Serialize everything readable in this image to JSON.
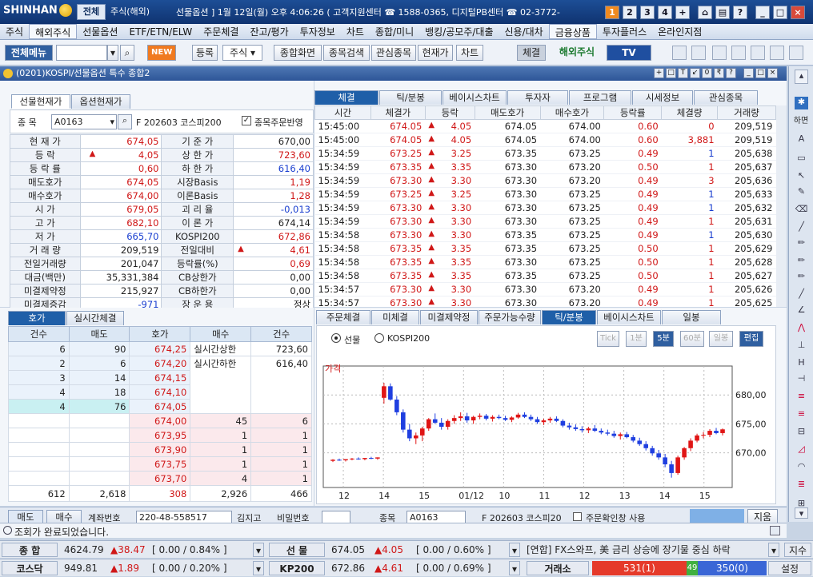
{
  "titlebar": {
    "logo": "SHINHAN",
    "tab_all": "전체",
    "tab_overseas": "주식(해외)",
    "status": "선물옵션 ] 1월 12일(월) 오후 4:06:26 ( 고객지원센터 ☎ 1588-0365, 디지털PB센터 ☎ 02-3772-",
    "page_buttons": [
      "1",
      "2",
      "3",
      "4",
      "+"
    ]
  },
  "menu": [
    "주식",
    "해외주식",
    "선물옵션",
    "ETF/ETN/ELW",
    "주문체결",
    "잔고/평가",
    "투자정보",
    "차트",
    "종합/미니",
    "뱅킹/공모주/대출",
    "신용/대차",
    "금융상품",
    "투자플러스",
    "온라인지점"
  ],
  "menu_selected": "해외주식",
  "toolbar": {
    "all_menu": "전체메뉴",
    "new_badge": "NEW",
    "register": "등록",
    "stock_select": "주식",
    "combined_screen": "종합화면",
    "search_stock": "종목검색",
    "interest": "관심종목",
    "current_price": "현재가",
    "chart": "차트",
    "trade": "체결",
    "overseas_stock": "해외주식",
    "tv": "TV"
  },
  "window": {
    "title": "(0201)KOSPI/선물옵션 특수 종합2",
    "ctrl_buttons": [
      "+",
      "□",
      "T",
      "↙",
      "0",
      "₹",
      "?",
      "_",
      "□",
      "×"
    ]
  },
  "quote_panel": {
    "tabs": [
      "선물현재가",
      "옵션현재가"
    ],
    "code_label": "종  목",
    "code": "A0163",
    "product": "F 202603 코스피200",
    "order_checkbox": "종목주문반영",
    "rows": [
      {
        "l1": "현 재 가",
        "v1": "674,05",
        "c1": "red",
        "l2": "기 준 가",
        "v2": "670,00",
        "c2": ""
      },
      {
        "l1": "등    락",
        "v1": "4,05",
        "c1": "red",
        "arrow": "▲",
        "l2": "상 한 가",
        "v2": "723,60",
        "c2": "red"
      },
      {
        "l1": "등 락 률",
        "v1": "0,60",
        "c1": "red",
        "l2": "하 한 가",
        "v2": "616,40",
        "c2": "blue"
      },
      {
        "l1": "매도호가",
        "v1": "674,05",
        "c1": "red",
        "l2": "시장Basis",
        "v2": "1,19",
        "c2": "red"
      },
      {
        "l1": "매수호가",
        "v1": "674,00",
        "c1": "red",
        "l2": "이론Basis",
        "v2": "1,28",
        "c2": "red"
      },
      {
        "l1": "시    가",
        "v1": "679,05",
        "c1": "red",
        "l2": "괴 리 율",
        "v2": "-0,013",
        "c2": "blue"
      },
      {
        "l1": "고    가",
        "v1": "682,10",
        "c1": "red",
        "l2": "이 론 가",
        "v2": "674,14",
        "c2": ""
      },
      {
        "l1": "저    가",
        "v1": "665,70",
        "c1": "blue",
        "l2": "KOSPI200",
        "v2": "672,86",
        "c2": "red"
      },
      {
        "l1": "거 래 량",
        "v1": "209,519",
        "c1": "",
        "l2": "전일대비",
        "v2": "4,61",
        "c2": "red",
        "arrow2": "▲"
      },
      {
        "l1": "전일거래량",
        "v1": "201,047",
        "c1": "",
        "l2": "등락률(%)",
        "v2": "0,69",
        "c2": "red"
      },
      {
        "l1": "대금(백만)",
        "v1": "35,331,384",
        "c1": "",
        "l2": "CB상한가",
        "v2": "0,00",
        "c2": ""
      },
      {
        "l1": "미결제약정",
        "v1": "215,927",
        "c1": "",
        "l2": "CB하한가",
        "v2": "0,00",
        "c2": ""
      },
      {
        "l1": "미결제증감",
        "v1": "-971",
        "c1": "blue",
        "l2": "장 운 용",
        "v2": "정상",
        "c2": ""
      }
    ]
  },
  "trade_panel": {
    "tabs": [
      "체결",
      "틱/분봉",
      "베이시스차트",
      "투자자",
      "프로그램",
      "시세정보",
      "관심종목"
    ],
    "headers": [
      "시간",
      "체결가",
      "등락",
      "매도호가",
      "매수호가",
      "등락률",
      "체결량",
      "거래량"
    ],
    "rows": [
      [
        "15:45:00",
        "674.05",
        "4.05",
        "674.05",
        "674.00",
        "0.60",
        "0",
        "209,519",
        "red"
      ],
      [
        "15:45:00",
        "674.05",
        "4.05",
        "674.05",
        "674.00",
        "0.60",
        "3,881",
        "209,519",
        "red"
      ],
      [
        "15:34:59",
        "673.25",
        "3.25",
        "673.35",
        "673.25",
        "0.49",
        "1",
        "205,638",
        "blue"
      ],
      [
        "15:34:59",
        "673.35",
        "3.35",
        "673.30",
        "673.20",
        "0.50",
        "1",
        "205,637",
        "red"
      ],
      [
        "15:34:59",
        "673.30",
        "3.30",
        "673.30",
        "673.20",
        "0.49",
        "3",
        "205,636",
        "red"
      ],
      [
        "15:34:59",
        "673.25",
        "3.25",
        "673.30",
        "673.25",
        "0.49",
        "1",
        "205,633",
        "blue"
      ],
      [
        "15:34:59",
        "673.30",
        "3.30",
        "673.30",
        "673.25",
        "0.49",
        "1",
        "205,632",
        "blue"
      ],
      [
        "15:34:59",
        "673.30",
        "3.30",
        "673.30",
        "673.25",
        "0.49",
        "1",
        "205,631",
        "red"
      ],
      [
        "15:34:58",
        "673.30",
        "3.30",
        "673.35",
        "673.25",
        "0.49",
        "1",
        "205,630",
        "blue"
      ],
      [
        "15:34:58",
        "673.35",
        "3.35",
        "673.35",
        "673.25",
        "0.50",
        "1",
        "205,629",
        "red"
      ],
      [
        "15:34:58",
        "673.35",
        "3.35",
        "673.30",
        "673.25",
        "0.50",
        "1",
        "205,628",
        "red"
      ],
      [
        "15:34:58",
        "673.35",
        "3.35",
        "673.35",
        "673.25",
        "0.50",
        "1",
        "205,627",
        "red"
      ],
      [
        "15:34:57",
        "673.30",
        "3.30",
        "673.30",
        "673.20",
        "0.49",
        "1",
        "205,626",
        "red"
      ],
      [
        "15:34:57",
        "673.30",
        "3.30",
        "673.30",
        "673.20",
        "0.49",
        "1",
        "205,625",
        "red"
      ]
    ]
  },
  "orderbook": {
    "tabs": [
      "호가",
      "실시간체결"
    ],
    "headers": [
      "건수",
      "매도",
      "호가",
      "매수",
      "건수"
    ],
    "asks": [
      {
        "cnt": "6",
        "qty": "90",
        "price": "674,25"
      },
      {
        "cnt": "2",
        "qty": "6",
        "price": "674,20"
      },
      {
        "cnt": "3",
        "qty": "14",
        "price": "674,15"
      },
      {
        "cnt": "4",
        "qty": "18",
        "price": "674,10"
      },
      {
        "cnt": "4",
        "qty": "76",
        "price": "674,05"
      }
    ],
    "bids": [
      {
        "price": "674,00",
        "qty": "45",
        "cnt": "6"
      },
      {
        "price": "673,95",
        "qty": "1",
        "cnt": "1"
      },
      {
        "price": "673,90",
        "qty": "1",
        "cnt": "1"
      },
      {
        "price": "673,75",
        "qty": "1",
        "cnt": "1"
      },
      {
        "price": "673,70",
        "qty": "4",
        "cnt": "1"
      }
    ],
    "upper_label": "실시간상한",
    "upper_value": "723,60",
    "lower_label": "실시간하한",
    "lower_value": "616,40",
    "totals": [
      "612",
      "2,618",
      "308",
      "2,926",
      "466"
    ]
  },
  "chart_panel": {
    "tabs": [
      "주문체결",
      "미체결",
      "미결제약정",
      "주문가능수량",
      "틱/분봉",
      "베이시스차트",
      "일봉"
    ],
    "radio_futures": "선물",
    "radio_kospi": "KOSPI200",
    "interval_buttons": [
      "Tick",
      "1분",
      "5분",
      "60분",
      "일봉"
    ],
    "edit_button": "편집",
    "price_label": "가격"
  },
  "chart_data": {
    "type": "candlestick",
    "y_ticks": [
      "680,00",
      "675,00",
      "670,00"
    ],
    "y_tick_values": [
      680,
      675,
      670
    ],
    "ylim": [
      664,
      685
    ],
    "x_ticks": [
      "12",
      "14",
      "15",
      "01/12",
      "10",
      "11",
      "12",
      "13",
      "14",
      "15"
    ],
    "colors": {
      "up": "#e01515",
      "down": "#1f3fe0"
    },
    "candles": [
      [
        668.6,
        668.9,
        668.4,
        668.8
      ],
      [
        668.8,
        669.0,
        668.6,
        668.7
      ],
      [
        668.7,
        668.9,
        668.5,
        668.9
      ],
      [
        668.9,
        669.1,
        668.7,
        669.0
      ],
      [
        669.0,
        669.2,
        668.8,
        668.9
      ],
      [
        668.9,
        669.1,
        668.7,
        669.1
      ],
      [
        669.1,
        669.3,
        668.9,
        669.0
      ],
      [
        669.0,
        669.2,
        668.8,
        669.2
      ],
      [
        679.5,
        682.1,
        678.5,
        681.5
      ],
      [
        681.5,
        682.0,
        679.0,
        679.2
      ],
      [
        679.2,
        679.8,
        676.5,
        677.0
      ],
      [
        677.0,
        677.5,
        673.5,
        674.0
      ],
      [
        674.0,
        675.0,
        672.0,
        672.5
      ],
      [
        672.5,
        673.5,
        671.5,
        673.0
      ],
      [
        673.0,
        674.5,
        672.0,
        674.2
      ],
      [
        674.2,
        676.0,
        673.8,
        675.8
      ],
      [
        675.8,
        676.8,
        675.0,
        675.2
      ],
      [
        675.2,
        676.0,
        674.0,
        674.5
      ],
      [
        674.5,
        675.8,
        674.0,
        675.5
      ],
      [
        675.5,
        676.5,
        675.0,
        676.0
      ],
      [
        676.0,
        677.0,
        675.5,
        676.3
      ],
      [
        676.3,
        676.9,
        675.2,
        675.6
      ],
      [
        675.6,
        676.4,
        675.0,
        676.2
      ],
      [
        676.2,
        676.8,
        675.8,
        676.4
      ],
      [
        676.4,
        676.7,
        675.6,
        675.9
      ],
      [
        675.9,
        676.5,
        675.4,
        676.2
      ],
      [
        676.2,
        676.6,
        675.8,
        676.0
      ],
      [
        676.0,
        676.4,
        675.5,
        675.7
      ],
      [
        675.7,
        676.3,
        675.3,
        676.1
      ],
      [
        676.1,
        676.9,
        675.9,
        676.6
      ],
      [
        676.6,
        677.0,
        676.0,
        676.2
      ],
      [
        676.2,
        676.6,
        675.5,
        675.8
      ],
      [
        675.8,
        676.2,
        675.0,
        675.3
      ],
      [
        675.3,
        675.9,
        674.8,
        675.6
      ],
      [
        675.6,
        676.2,
        675.2,
        675.9
      ],
      [
        675.9,
        676.3,
        675.3,
        675.5
      ],
      [
        675.5,
        675.8,
        674.4,
        674.7
      ],
      [
        674.7,
        675.2,
        674.0,
        674.4
      ],
      [
        674.4,
        674.9,
        673.8,
        674.1
      ],
      [
        674.1,
        674.6,
        673.5,
        673.9
      ],
      [
        673.9,
        674.5,
        673.4,
        674.2
      ],
      [
        674.2,
        674.8,
        673.6,
        673.8
      ],
      [
        673.8,
        674.2,
        673.2,
        673.5
      ],
      [
        673.5,
        674.0,
        673.0,
        673.3
      ],
      [
        673.3,
        673.8,
        672.6,
        672.9
      ],
      [
        672.9,
        673.5,
        672.3,
        673.2
      ],
      [
        673.2,
        673.6,
        672.5,
        672.7
      ],
      [
        672.7,
        673.1,
        671.8,
        672.1
      ],
      [
        672.1,
        672.6,
        671.2,
        671.5
      ],
      [
        671.5,
        672.0,
        670.4,
        670.8
      ],
      [
        670.8,
        671.2,
        669.5,
        669.9
      ],
      [
        669.9,
        670.5,
        668.8,
        669.2
      ],
      [
        669.2,
        669.8,
        667.5,
        668.0
      ],
      [
        668.0,
        668.6,
        665.7,
        666.5
      ],
      [
        666.5,
        669.5,
        666.2,
        669.2
      ],
      [
        669.2,
        671.0,
        668.8,
        670.8
      ],
      [
        670.8,
        672.5,
        670.3,
        672.1
      ],
      [
        672.1,
        673.3,
        671.8,
        673.0
      ],
      [
        673.0,
        673.6,
        672.5,
        673.1
      ],
      [
        673.1,
        674.1,
        672.7,
        673.8
      ],
      [
        673.8,
        674.3,
        673.2,
        673.4
      ],
      [
        673.4,
        674.2,
        673.0,
        674.05
      ]
    ]
  },
  "order_strip": {
    "sell_tab": "매도",
    "buy_tab": "매수",
    "account_label": "계좌번호",
    "account": "220-48-558517",
    "name": "김지고",
    "password_label": "비밀번호",
    "code_label": "종목",
    "code": "A0163",
    "product": "F 202603 코스피20",
    "checkbox": "주문확인창 사용",
    "clear_button": "지움"
  },
  "status_bar": {
    "message": "조회가 완료되었습니다."
  },
  "ticker1": {
    "label1": "종  합",
    "idx1": "4624.79",
    "chg1": "▲38.47",
    "bracket1": "[ 0.00  /  0.84% ]",
    "label2": "선  물",
    "idx2": "674.05",
    "chg2": "▲4.05",
    "bracket2": "[ 0.00  /  0.60% ]",
    "news": "[연합] FX스와프, 美 금리 상승에 장기물 중심 하락",
    "right": "지수"
  },
  "ticker2": {
    "label1": "코스닥",
    "idx1": "949.81",
    "chg1": "▲1.89",
    "bracket1": "[ 0.00  /  0.20% ]",
    "label2": "KP200",
    "idx2": "672.86",
    "chg2": "▲4.61",
    "bracket2": "[ 0.00  /  0.69% ]",
    "exchange_label": "거래소",
    "up_count": "531(1)",
    "flat_count": "49",
    "down_count": "350(0)",
    "right": "설정"
  }
}
